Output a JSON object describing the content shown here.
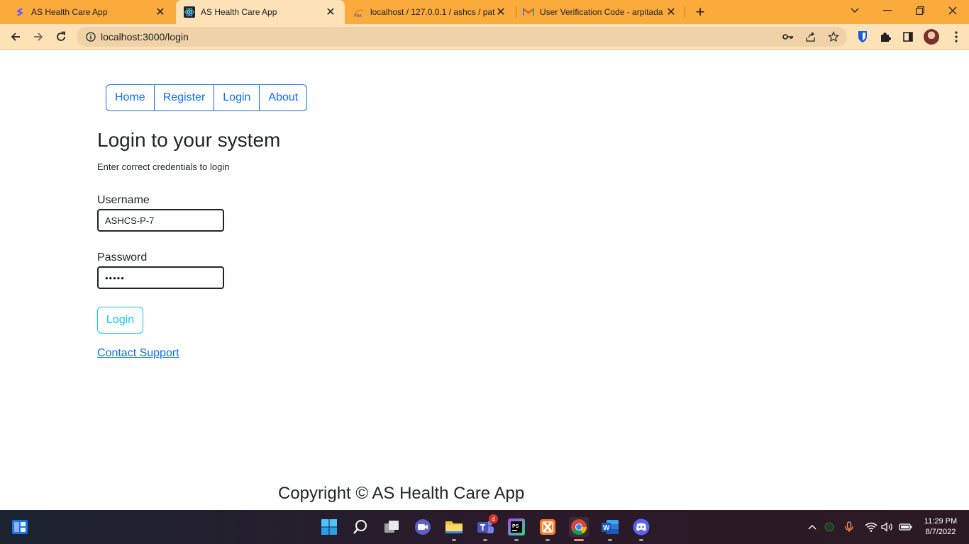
{
  "browser": {
    "tabs": [
      {
        "title": "AS Health Care App",
        "favicon": "stripe-s-icon",
        "active": false
      },
      {
        "title": "AS Health Care App",
        "favicon": "react-icon",
        "active": true
      },
      {
        "title": "localhost / 127.0.0.1 / ashcs / pat",
        "favicon": "phpmyadmin-icon",
        "active": false
      },
      {
        "title": "User Verification Code - arpitada",
        "favicon": "gmail-icon",
        "active": false
      }
    ],
    "address": "localhost:3000/login",
    "tab_strip_color": "#fbab3c",
    "toolbar_color": "#fde2b8"
  },
  "page": {
    "nav": [
      "Home",
      "Register",
      "Login",
      "About"
    ],
    "heading": "Login to your system",
    "subtext": "Enter correct credentials to login",
    "username_label": "Username",
    "username_value": "ASHCS-P-7",
    "password_label": "Password",
    "password_value": "•••••",
    "login_button": "Login",
    "support_link": "Contact Support",
    "footer": "Copyright © AS Health Care App",
    "primary_color": "#0d6efd",
    "info_color": "#0dcaf0"
  },
  "taskbar": {
    "apps": [
      "start-icon",
      "search-icon",
      "task-view-icon",
      "zoom-icon",
      "file-explorer-icon",
      "teams-icon",
      "phpstorm-icon",
      "xampp-icon",
      "chrome-icon",
      "word-icon",
      "discord-icon"
    ],
    "teams_badge": "4",
    "clock_time": "11:29 PM",
    "clock_date": "8/7/2022"
  }
}
